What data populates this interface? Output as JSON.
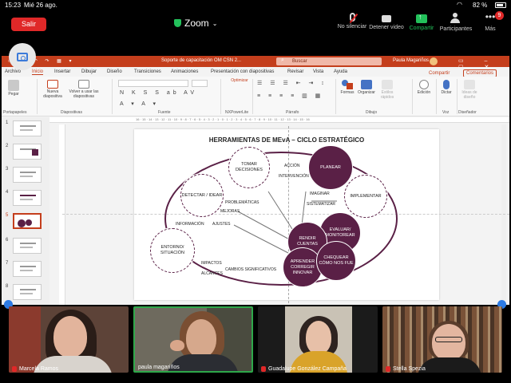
{
  "status_bar": {
    "time": "15:23",
    "date": "Mié 26 ago.",
    "battery": "82 %",
    "battery_level": 0.82
  },
  "zoom": {
    "leave_label": "Salir",
    "title": "Zoom",
    "buttons": [
      {
        "label": "No silenciar",
        "icon": "mic-muted-icon"
      },
      {
        "label": "Detener video",
        "icon": "camera-icon"
      },
      {
        "label": "Compartir",
        "icon": "share-screen-icon"
      },
      {
        "label": "Participantes",
        "icon": "participants-icon"
      },
      {
        "label": "Más",
        "icon": "more-icon"
      }
    ],
    "participant_count": "9",
    "accent": "#23c15b",
    "leave_color": "#e02828"
  },
  "ppt": {
    "doc_title": "Soporte de capacitación OM CSN 2...",
    "search_placeholder": "Buscar",
    "user": "Paula Magariños",
    "brand_color": "#c43e1c",
    "tabs": [
      "Archivo",
      "Inicio",
      "Insertar",
      "Dibujar",
      "Diseño",
      "Transiciones",
      "Animaciones",
      "Presentación con diapositivas",
      "Revisar",
      "Vista",
      "Ayuda"
    ],
    "active_tab": "Inicio",
    "share_label": "Compartir",
    "comments_label": "Comentarios",
    "ribbon": {
      "paste": "Pegar",
      "new_slide": "Nueva diapositiva",
      "reuse_slides": "Volver a usar las diapositivas",
      "optimize": "Optimizar",
      "shapes": "Formas",
      "arrange": "Organizar",
      "quick_styles": "Estilos rápidos",
      "editing": "Edición",
      "dictate": "Dictar",
      "design_ideas": "Ideas de diseño",
      "groups": [
        "Portapapeles",
        "Diapositivas",
        "Fuente",
        "NXPowerLite",
        "Párrafo",
        "Dibujo",
        "Voz",
        "Diseñador"
      ]
    },
    "ruler_marks": "16 · 15 · 14 · 13 · 12 · 11 · 10 · 9 · 8 · 7 · 6 · 5 · 4 · 3 · 2 · 1 · 0 · 1 · 2 · 3 · 4 · 5 · 6 · 7 · 8 · 9 · 10 · 11 · 12 · 13 · 14 · 15 · 16",
    "slide_numbers": [
      "1",
      "2",
      "3",
      "4",
      "5",
      "6",
      "7",
      "8"
    ],
    "selected_slide": 5
  },
  "slide": {
    "title": "HERRAMIENTAS DE MEvA – CICLO ESTRATÉGICO",
    "circles": {
      "tomar": "TOMAR DECISIONES",
      "planear": "PLANEAR",
      "detectar": "DETECTAR / IDEAR",
      "implementar": "IMPLEMENTAR",
      "evaluar": "EVALUAR/ MONITOREAR",
      "rendir": "RENDIR CUENTAS",
      "entorno": "ENTORNO/ SITUACIÓN",
      "aprender": "APRENDER CORREGIR INNOVAR",
      "chequear": "CHEQUEAR CÓMO NOS FUE"
    },
    "labels": {
      "accion": "ACCIÓN",
      "intervencion": "INTERVENCIÓN",
      "imaginar": "IMAGINAR",
      "sistematizar": "SISTEMATIZAR",
      "problematicas": "PROBLEMÁTICAS",
      "mejoras": "MEJORAS",
      "informacion": "INFORMACIÓN",
      "ajustes": "AJUSTES",
      "impactos": "IMPACTOS",
      "alcances": "ALCANCES",
      "cambios": "CAMBIOS SIGNIFICATIVOS"
    },
    "accent": "#5a2046"
  },
  "participants": [
    {
      "name": "Marcela Ramos",
      "muted": true
    },
    {
      "name": "paula magariños",
      "muted": false,
      "active": true
    },
    {
      "name": "Guadalupe González Campaña",
      "muted": true
    },
    {
      "name": "Stella Spezia",
      "muted": true
    }
  ]
}
